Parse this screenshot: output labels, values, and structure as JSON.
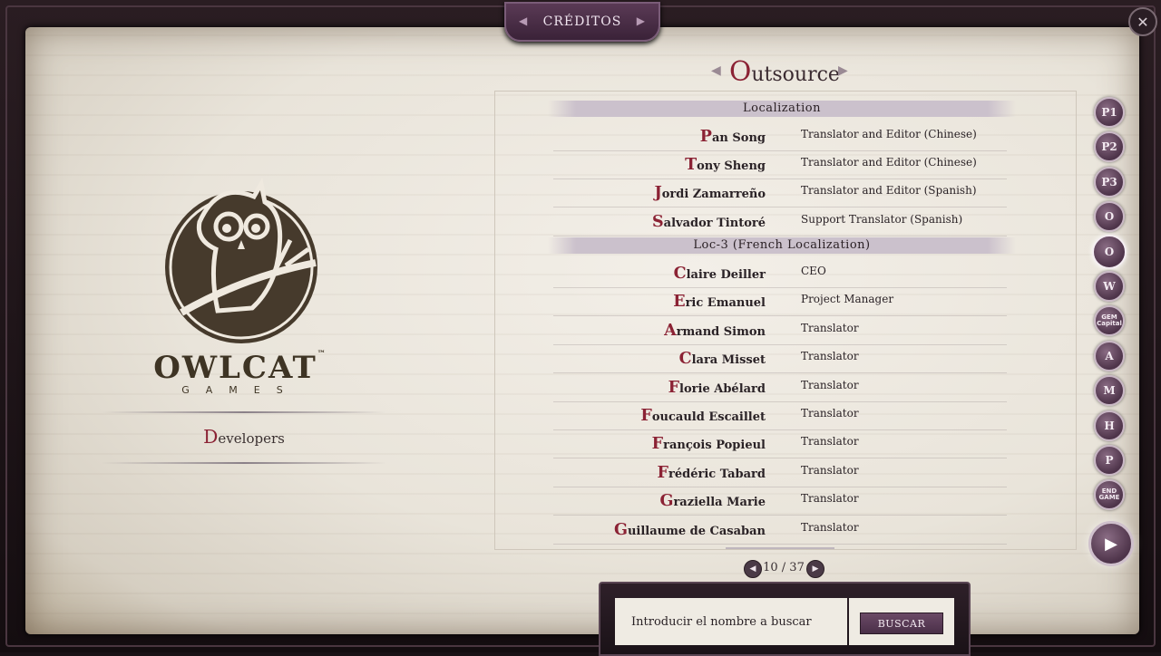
{
  "header": {
    "title": "CRÉDITOS"
  },
  "left_panel": {
    "brand_name": "OWLCAT",
    "brand_trademark": "™",
    "brand_sub": "GAMES",
    "category_initial": "D",
    "category_rest": "evelopers"
  },
  "right_panel": {
    "heading_initial": "O",
    "heading_rest": "utsource",
    "sections": [
      {
        "title": "Localization",
        "entries": [
          {
            "initial": "P",
            "rest": "an Song",
            "role": "Translator and Editor (Chinese)"
          },
          {
            "initial": "T",
            "rest": "ony Sheng",
            "role": "Translator and Editor (Chinese)"
          },
          {
            "initial": "J",
            "rest": "ordi Zamarreño",
            "role": "Translator and Editor (Spanish)"
          },
          {
            "initial": "S",
            "rest": "alvador Tintoré",
            "role": "Support Translator (Spanish)"
          }
        ]
      },
      {
        "title": "Loc-3 (French Localization)",
        "entries": [
          {
            "initial": "C",
            "rest": "laire Deiller",
            "role": "CEO"
          },
          {
            "initial": "E",
            "rest": "ric Emanuel",
            "role": "Project Manager"
          },
          {
            "initial": "A",
            "rest": "rmand Simon",
            "role": "Translator"
          },
          {
            "initial": "C",
            "rest": "lara Misset",
            "role": "Translator"
          },
          {
            "initial": "F",
            "rest": "lorie Abélard",
            "role": "Translator"
          },
          {
            "initial": "F",
            "rest": "oucauld Escaillet",
            "role": "Translator"
          },
          {
            "initial": "F",
            "rest": "rançois Popieul",
            "role": "Translator"
          },
          {
            "initial": "F",
            "rest": "rédéric Tabard",
            "role": "Translator"
          },
          {
            "initial": "G",
            "rest": "raziella Marie",
            "role": "Translator"
          },
          {
            "initial": "G",
            "rest": "uillaume de Casaban",
            "role": "Translator"
          }
        ]
      }
    ]
  },
  "pagination": {
    "text": "10 / 37"
  },
  "side_icons": [
    {
      "name": "pathfinder-1-icon",
      "glyph": "P1"
    },
    {
      "name": "pathfinder-2-icon",
      "glyph": "P2"
    },
    {
      "name": "pathfinder-3-icon",
      "glyph": "P3"
    },
    {
      "name": "owlcat-icon",
      "glyph": "O"
    },
    {
      "name": "outsource-icon",
      "glyph": "O",
      "active": true
    },
    {
      "name": "wave-logo-icon",
      "glyph": "W"
    },
    {
      "name": "gem-capital-icon",
      "glyph": "GEM Capital"
    },
    {
      "name": "armor-icon",
      "glyph": "A"
    },
    {
      "name": "chevron-logo-icon",
      "glyph": "M"
    },
    {
      "name": "hexagon-logo-icon",
      "glyph": "H"
    },
    {
      "name": "pathfinder-icon",
      "glyph": "P"
    },
    {
      "name": "end-game-icon",
      "glyph": "END GAME"
    }
  ],
  "search": {
    "placeholder": "Introducir el nombre a buscar",
    "button_label": "BUSCAR"
  },
  "colors": {
    "accent": "#8b2234",
    "frame": "#2a1d22",
    "button": "#5a3a55"
  }
}
